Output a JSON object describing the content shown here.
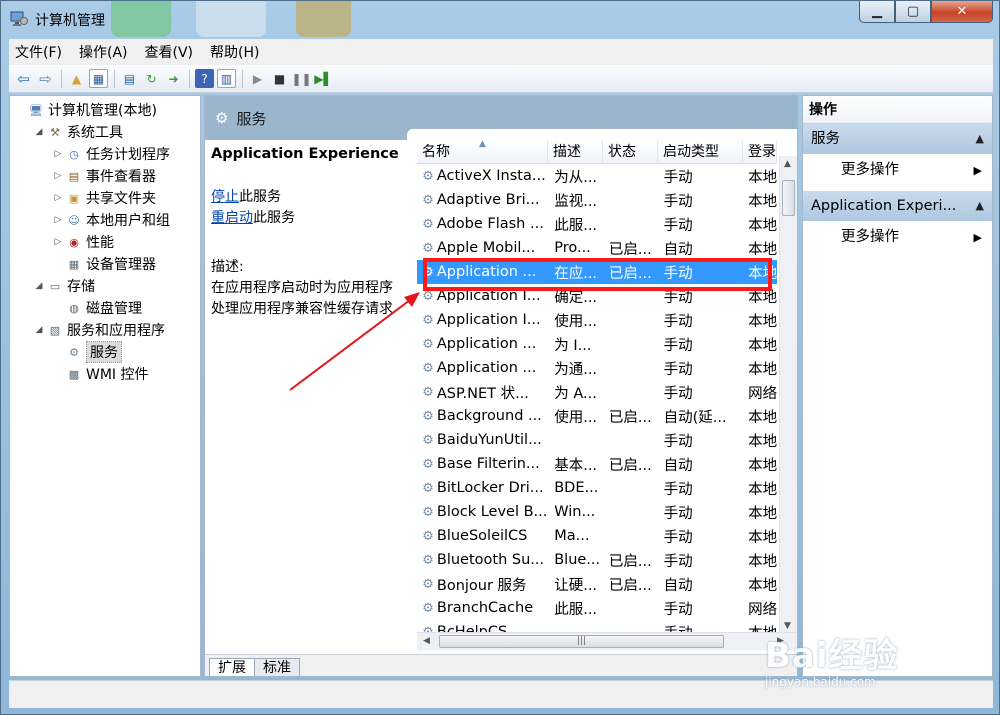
{
  "window": {
    "title": "计算机管理"
  },
  "menu": [
    "文件(F)",
    "操作(A)",
    "查看(V)",
    "帮助(H)"
  ],
  "tree": [
    {
      "label": "计算机管理(本地)",
      "indent": 0,
      "toggle": "",
      "icon": "computer-icon"
    },
    {
      "label": "系统工具",
      "indent": 1,
      "toggle": "◢",
      "icon": "tools-icon"
    },
    {
      "label": "任务计划程序",
      "indent": 2,
      "toggle": "▷",
      "icon": "clock-icon"
    },
    {
      "label": "事件查看器",
      "indent": 2,
      "toggle": "▷",
      "icon": "event-viewer-icon"
    },
    {
      "label": "共享文件夹",
      "indent": 2,
      "toggle": "▷",
      "icon": "shared-folder-icon"
    },
    {
      "label": "本地用户和组",
      "indent": 2,
      "toggle": "▷",
      "icon": "users-icon"
    },
    {
      "label": "性能",
      "indent": 2,
      "toggle": "▷",
      "icon": "performance-icon"
    },
    {
      "label": "设备管理器",
      "indent": 2,
      "toggle": "",
      "icon": "device-manager-icon"
    },
    {
      "label": "存储",
      "indent": 1,
      "toggle": "◢",
      "icon": "storage-icon"
    },
    {
      "label": "磁盘管理",
      "indent": 2,
      "toggle": "",
      "icon": "disk-icon"
    },
    {
      "label": "服务和应用程序",
      "indent": 1,
      "toggle": "◢",
      "icon": "services-apps-icon"
    },
    {
      "label": "服务",
      "indent": 2,
      "toggle": "",
      "icon": "gear-icon",
      "selected": true
    },
    {
      "label": "WMI 控件",
      "indent": 2,
      "toggle": "",
      "icon": "wmi-icon"
    }
  ],
  "center": {
    "header": "服务",
    "service_name": "Application Experience",
    "stop_link": "停止",
    "stop_suffix": "此服务",
    "restart_link": "重启动",
    "restart_suffix": "此服务",
    "desc_label": "描述:",
    "desc_line1": "在应用程序启动时为应用程序",
    "desc_line2": "处理应用程序兼容性缓存请求"
  },
  "columns": [
    "名称",
    "描述",
    "状态",
    "启动类型",
    "登录"
  ],
  "services": [
    [
      "ActiveX Insta...",
      "为从...",
      "",
      "手动",
      "本地"
    ],
    [
      "Adaptive Bri...",
      "监视...",
      "",
      "手动",
      "本地"
    ],
    [
      "Adobe Flash ...",
      "此服...",
      "",
      "手动",
      "本地"
    ],
    [
      "Apple Mobil...",
      "Pro...",
      "已启...",
      "自动",
      "本地"
    ],
    [
      "Application ...",
      "在应...",
      "已启...",
      "手动",
      "本地"
    ],
    [
      "Application I...",
      "确定...",
      "",
      "手动",
      "本地"
    ],
    [
      "Application I...",
      "使用...",
      "",
      "手动",
      "本地"
    ],
    [
      "Application ...",
      "为 I...",
      "",
      "手动",
      "本地"
    ],
    [
      "Application ...",
      "为通...",
      "",
      "手动",
      "本地"
    ],
    [
      "ASP.NET 状...",
      "为 A...",
      "",
      "手动",
      "网络"
    ],
    [
      "Background ...",
      "使用...",
      "已启...",
      "自动(延...",
      "本地"
    ],
    [
      "BaiduYunUtil...",
      "",
      "",
      "手动",
      "本地"
    ],
    [
      "Base Filterin...",
      "基本...",
      "已启...",
      "自动",
      "本地"
    ],
    [
      "BitLocker Dri...",
      "BDE...",
      "",
      "手动",
      "本地"
    ],
    [
      "Block Level B...",
      "Win...",
      "",
      "手动",
      "本地"
    ],
    [
      "BlueSoleilCS",
      "Ma...",
      "",
      "手动",
      "本地"
    ],
    [
      "Bluetooth Su...",
      "Blue...",
      "已启...",
      "手动",
      "本地"
    ],
    [
      "Bonjour 服务",
      "让硬...",
      "已启...",
      "自动",
      "本地"
    ],
    [
      "BranchCache",
      "此服...",
      "",
      "手动",
      "网络"
    ],
    [
      "BcHelpCS",
      "",
      "",
      "手动",
      "本地"
    ]
  ],
  "selected_row": 4,
  "tabs": [
    "扩展",
    "标准"
  ],
  "actions": {
    "header": "操作",
    "section1": "服务",
    "more1": "更多操作",
    "section2": "Application Experi...",
    "more2": "更多操作"
  },
  "watermark": {
    "logo": "Bai经验",
    "url": "jingyan.baidu.com"
  },
  "colors": {
    "selection": "#3399ff",
    "highlight_box": "#ff1a1a",
    "link": "#0645ad"
  }
}
